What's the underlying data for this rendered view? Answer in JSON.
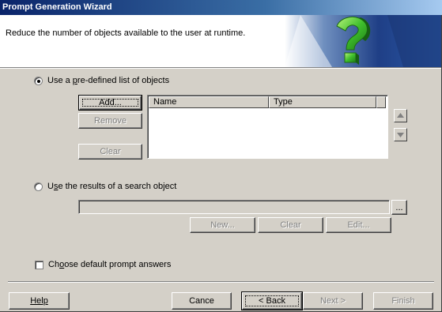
{
  "window": {
    "title": "Prompt Generation Wizard"
  },
  "header": {
    "text": "Reduce the number of objects available to the user at runtime."
  },
  "predefined": {
    "label_prefix": "Use a ",
    "label_key": "p",
    "label_suffix": "re-defined list of objects",
    "checked": true,
    "add_button": "Add...",
    "remove_button": "Remove",
    "clear_button": "Clear",
    "columns": [
      "Name",
      "Type"
    ]
  },
  "search": {
    "label_prefix": "U",
    "label_key": "s",
    "label_suffix": "e the results of a search object",
    "checked": false,
    "browse_button": "...",
    "new_button": "New...",
    "clear_button": "Clear",
    "edit_button": "Edit..."
  },
  "defaults": {
    "label_prefix": "Ch",
    "label_key": "o",
    "label_suffix": "ose default prompt answers",
    "checked": false
  },
  "footer": {
    "help": "Help",
    "cancel": "Cance",
    "back": "< Back",
    "next": "Next >",
    "finish": "Finish"
  }
}
